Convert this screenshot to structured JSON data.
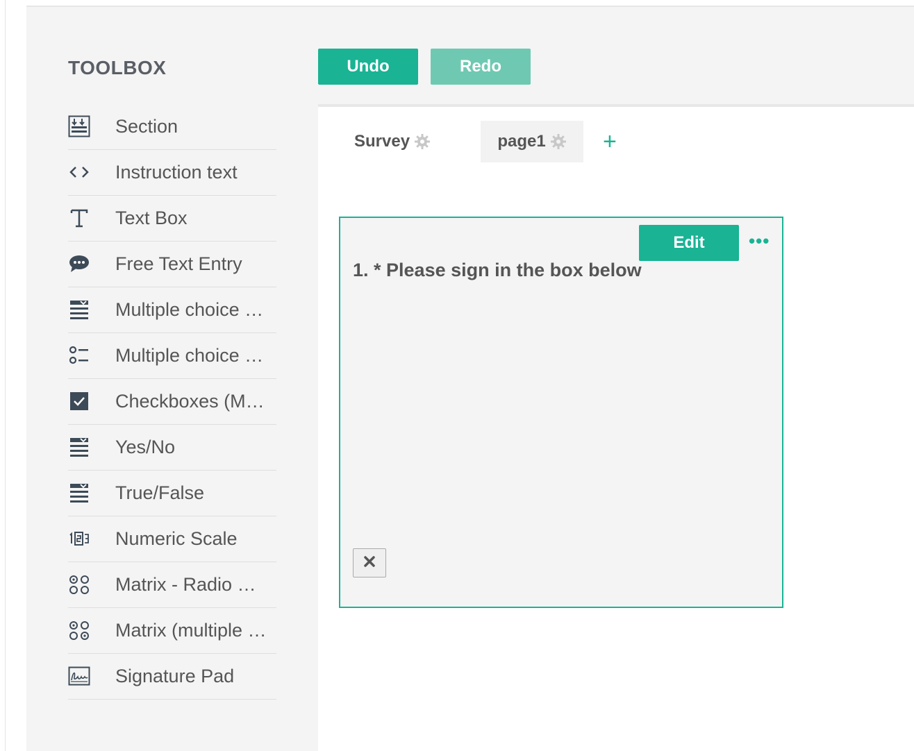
{
  "toolbox": {
    "title": "TOOLBOX",
    "items": [
      {
        "label": "Section",
        "icon": "section-icon"
      },
      {
        "label": "Instruction text",
        "icon": "code-icon"
      },
      {
        "label": "Text Box",
        "icon": "text-icon"
      },
      {
        "label": "Free Text Entry",
        "icon": "comment-icon"
      },
      {
        "label": "Multiple choice …",
        "icon": "dropdown-icon"
      },
      {
        "label": "Multiple choice …",
        "icon": "radiogroup-icon"
      },
      {
        "label": "Checkboxes (M…",
        "icon": "checkbox-icon"
      },
      {
        "label": "Yes/No",
        "icon": "dropdown-icon"
      },
      {
        "label": "True/False",
        "icon": "dropdown-icon"
      },
      {
        "label": "Numeric Scale",
        "icon": "rating-icon"
      },
      {
        "label": "Matrix - Radio …",
        "icon": "matrix-icon"
      },
      {
        "label": "Matrix (multiple …",
        "icon": "matrix-icon"
      },
      {
        "label": "Signature Pad",
        "icon": "signature-icon"
      }
    ]
  },
  "toolbar": {
    "undo_label": "Undo",
    "redo_label": "Redo"
  },
  "tabs": [
    {
      "label": "Survey",
      "icon": "gear-icon"
    },
    {
      "label": "page1",
      "icon": "gear-icon"
    }
  ],
  "add_page_label": "+",
  "question": {
    "title": "1. * Please sign in the box below",
    "edit_label": "Edit",
    "more_label": "•••"
  },
  "colors": {
    "accent": "#1ab394",
    "accent_light": "#6fc9b2",
    "icon": "#3d4a57"
  }
}
